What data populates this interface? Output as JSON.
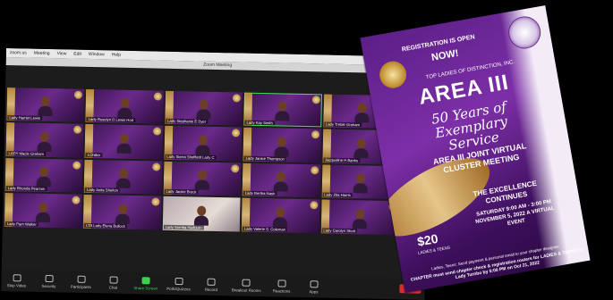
{
  "zoom": {
    "menubar": [
      "zoom.us",
      "Meeting",
      "View",
      "Edit",
      "Window",
      "Help"
    ],
    "window_title": "Zoom Meeting",
    "participants": [
      {
        "name": "Lady Harriet Lewis"
      },
      {
        "name": "Lady Roselyn D Lewis Hod"
      },
      {
        "name": "Lady Stephanie E Dyer"
      },
      {
        "name": "Lady Kay Smith"
      },
      {
        "name": "Lady Treble Graham"
      },
      {
        "name": "LADY Macie Graham"
      },
      {
        "name": "LChiller"
      },
      {
        "name": "Lady Sierra Sheffield Lady C"
      },
      {
        "name": "Lady Janice Thompson"
      },
      {
        "name": "Jacqueline H Banks"
      },
      {
        "name": "Lady Rhonda Pearson"
      },
      {
        "name": "Lady Anita Shelton"
      },
      {
        "name": "Lady Jackie Brock"
      },
      {
        "name": "Lady Bertha Nash"
      },
      {
        "name": "Lady Zita Harris"
      },
      {
        "name": "Lady Pam Walker"
      },
      {
        "name": "LTA Lady Elena Bullock"
      },
      {
        "name": "Lady Sorritta Hadburn"
      },
      {
        "name": "Lady Valerie S. Coleman"
      },
      {
        "name": "Lady Carolyn Short"
      }
    ],
    "toolbar": [
      {
        "label": "Stop Video",
        "icon": "video-icon"
      },
      {
        "label": "Security",
        "icon": "shield-icon"
      },
      {
        "label": "Participants",
        "icon": "people-icon"
      },
      {
        "label": "Chat",
        "icon": "chat-icon"
      },
      {
        "label": "Share Screen",
        "icon": "share-screen-icon"
      },
      {
        "label": "Polls/Quizzes",
        "icon": "poll-icon"
      },
      {
        "label": "Record",
        "icon": "record-icon"
      },
      {
        "label": "Breakout Rooms",
        "icon": "breakout-icon"
      },
      {
        "label": "Reactions",
        "icon": "smile-icon"
      },
      {
        "label": "Apps",
        "icon": "apps-icon"
      }
    ],
    "leave_label": "Leave"
  },
  "flyer": {
    "registration": "REGISTRATION IS OPEN",
    "now": "NOW!",
    "org": "TOP LADIES OF DISTINCTION, INC.",
    "area": "AREA III",
    "fifty": "50 Years of Exemplary Service",
    "meeting": "AREA III JOINT VIRTUAL CLUSTER MEETING",
    "excellence": "THE EXCELLENCE CONTINUES",
    "date": "SATURDAY 9:00 AM - 3:00 PM NOVEMBER 5, 2022 A VIRTUAL EVENT",
    "price": "$20",
    "price_sub": "LADIES & TEENS",
    "note1": "Ladies, Teens: Send payment & personal email to your chapter designee",
    "note2": "CHAPTER must send chapter check & registration rosters for LADIES & TEENS to Lady Turnbo by 5:00 PM on Oct 21, 2022"
  },
  "colors": {
    "flyer_purple": "#5b1f86",
    "gold": "#c49234",
    "leave_red": "#e02b2b",
    "active_green": "#42e05a"
  }
}
